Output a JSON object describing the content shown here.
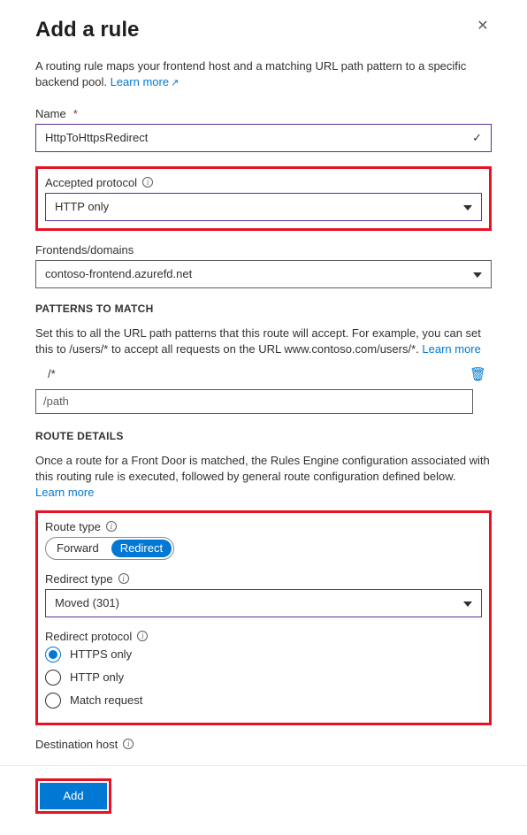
{
  "header": {
    "title": "Add a rule"
  },
  "intro": {
    "text": "A routing rule maps your frontend host and a matching URL path pattern to a specific backend pool. ",
    "link": "Learn more"
  },
  "fields": {
    "name": {
      "label": "Name",
      "value": "HttpToHttpsRedirect"
    },
    "protocol": {
      "label": "Accepted protocol",
      "value": "HTTP only"
    },
    "frontends": {
      "label": "Frontends/domains",
      "value": "contoso-frontend.azurefd.net"
    }
  },
  "patterns": {
    "heading": "PATTERNS TO MATCH",
    "desc_a": "Set this to all the URL path patterns that this route will accept. For example, you can set this to /users/* to accept all requests on the URL www.contoso.com/users/*. ",
    "desc_link": "Learn more",
    "rows": [
      "/*"
    ],
    "placeholder": "/path"
  },
  "route": {
    "heading": "ROUTE DETAILS",
    "desc": "Once a route for a Front Door is matched, the Rules Engine configuration associated with this routing rule is executed, followed by general route configuration defined below.",
    "learn": "Learn more",
    "route_type_label": "Route type",
    "route_type_options": {
      "forward": "Forward",
      "redirect": "Redirect"
    },
    "route_type_selected": "redirect",
    "redirect_type_label": "Redirect type",
    "redirect_type_value": "Moved (301)",
    "redirect_protocol_label": "Redirect protocol",
    "redirect_protocol_options": [
      "HTTPS only",
      "HTTP only",
      "Match request"
    ],
    "redirect_protocol_selected": "HTTPS only",
    "destination_host_label": "Destination host"
  },
  "footer": {
    "add": "Add"
  }
}
